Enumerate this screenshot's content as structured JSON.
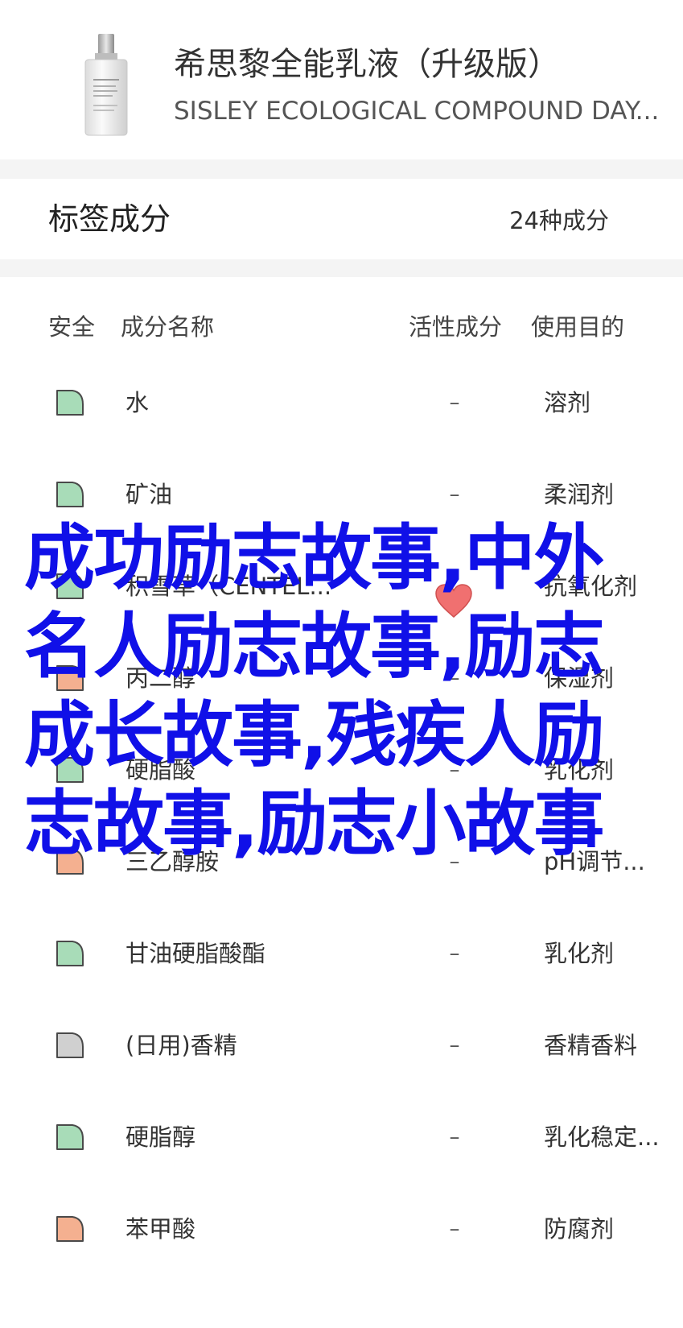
{
  "product": {
    "name_cn": "希思黎全能乳液（升级版）",
    "name_en": "SISLEY ECOLOGICAL COMPOUND DAY...",
    "image_icon": "lotion-bottle-icon"
  },
  "tags": {
    "title": "标签成分",
    "count": "24种成分"
  },
  "table": {
    "headers": {
      "safety": "安全",
      "name": "成分名称",
      "active": "活性成分",
      "purpose": "使用目的"
    },
    "rows": [
      {
        "name": "水",
        "active": "–",
        "purpose": "溶剂",
        "safety_color": "#a8dcb8"
      },
      {
        "name": "矿油",
        "active": "–",
        "purpose": "柔润剂",
        "safety_color": "#a8dcb8"
      },
      {
        "name": "积雪草（CENTEL...",
        "active": "",
        "purpose": "抗氧化剂",
        "safety_color": "#a8dcb8"
      },
      {
        "name": "丙二醇",
        "active": "–",
        "purpose": "保湿剂",
        "safety_color": "#f4b090"
      },
      {
        "name": "硬脂酸",
        "active": "–",
        "purpose": "乳化剂",
        "safety_color": "#a8dcb8"
      },
      {
        "name": "三乙醇胺",
        "active": "–",
        "purpose": "pH调节...",
        "safety_color": "#f4b090"
      },
      {
        "name": "甘油硬脂酸酯",
        "active": "–",
        "purpose": "乳化剂",
        "safety_color": "#a8dcb8"
      },
      {
        "name": "(日用)香精",
        "active": "–",
        "purpose": "香精香料",
        "safety_color": "#d0d0d0"
      },
      {
        "name": "硬脂醇",
        "active": "–",
        "purpose": "乳化稳定...",
        "safety_color": "#a8dcb8"
      },
      {
        "name": "苯甲酸",
        "active": "–",
        "purpose": "防腐剂",
        "safety_color": "#f4b090"
      }
    ]
  },
  "active_marker": {
    "icon": "heart-icon",
    "color": "#f07070"
  },
  "overlay": {
    "text": "成功励志故事,中外名人励志故事,励志成长故事,残疾人励志故事,励志小故事",
    "color": "#1010e8"
  }
}
